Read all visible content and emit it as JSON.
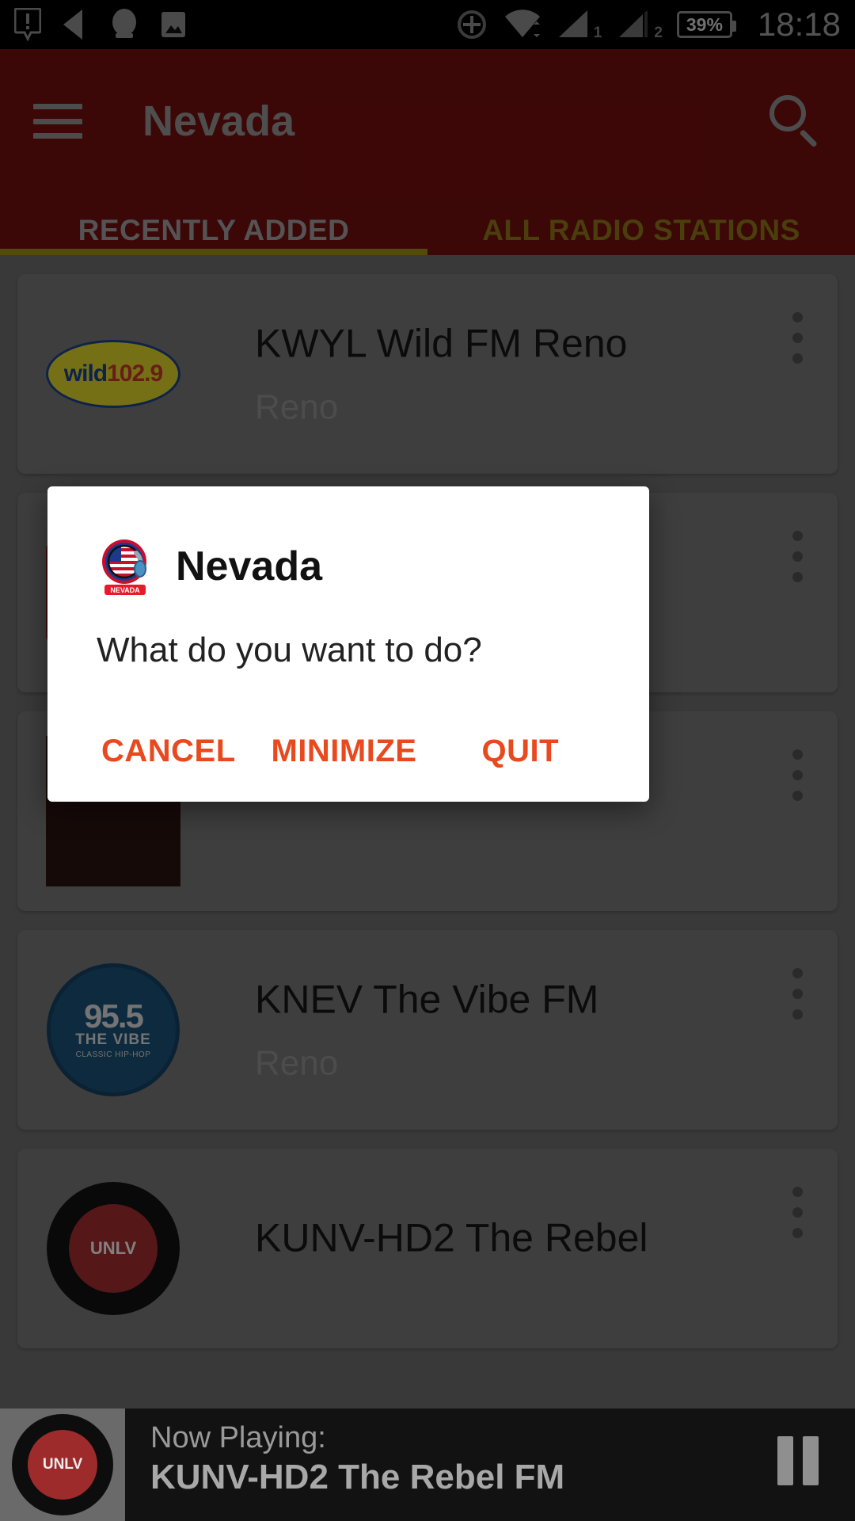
{
  "status_bar": {
    "time": "18:18",
    "battery_text": "39%",
    "icons": [
      "warning-icon",
      "back-icon",
      "chat-icon",
      "image-icon",
      "location-icon",
      "wifi-icon",
      "signal-1-icon",
      "signal-2-icon",
      "battery-icon"
    ],
    "sim1_label": "1",
    "sim2_label": "2"
  },
  "app_bar": {
    "title": "Nevada",
    "menu_icon": "hamburger-icon",
    "search_icon": "search-icon",
    "background": "#700d0d"
  },
  "tabs": [
    {
      "label": "RECENTLY ADDED",
      "active": true
    },
    {
      "label": "ALL RADIO STATIONS",
      "active": false
    }
  ],
  "stations": [
    {
      "name": "KWYL Wild FM Reno",
      "city": "Reno",
      "logo": "wild-1029-logo"
    },
    {
      "name": "",
      "city": "",
      "logo": "red-station-logo"
    },
    {
      "name": "",
      "city": "",
      "logo": "brown-station-logo"
    },
    {
      "name": "KNEV The Vibe FM",
      "city": "Reno",
      "logo": "vibe-955-logo"
    },
    {
      "name": "KUNV-HD2 The Rebel",
      "city": "",
      "logo": "unlv-rebel-radio-logo"
    }
  ],
  "station_logo_text": {
    "wild_prefix": "wild",
    "wild_freq": "102.9",
    "vibe_number": "95.5",
    "vibe_name": "THE VIBE",
    "vibe_sub": "CLASSIC HIP-HOP",
    "unlv": "UNLV"
  },
  "dialog": {
    "icon": "nevada-app-icon",
    "title": "Nevada",
    "message": "What do you want to do?",
    "buttons": [
      {
        "label": "CANCEL",
        "name": "cancel-button"
      },
      {
        "label": "MINIMIZE",
        "name": "minimize-button"
      },
      {
        "label": "QUIT",
        "name": "quit-button"
      }
    ],
    "button_color": "#e8491e"
  },
  "player": {
    "now_playing_label": "Now Playing:",
    "station": "KUNV-HD2 The Rebel FM",
    "control_icon": "pause-icon"
  }
}
